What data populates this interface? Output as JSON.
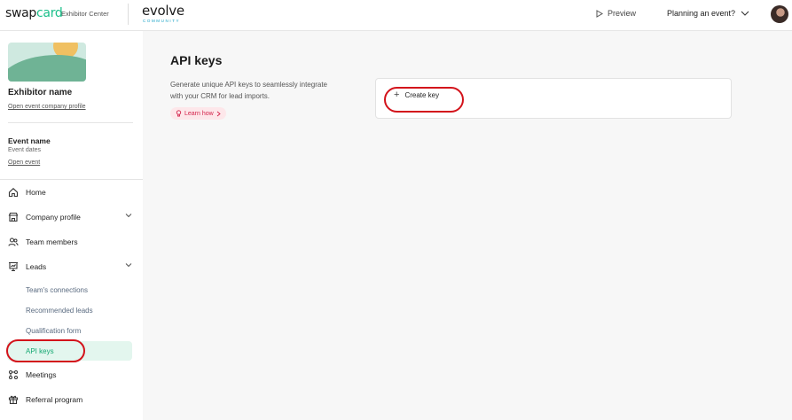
{
  "header": {
    "brand_prefix": "swap",
    "brand_accent": "card",
    "brand_sub": "Exhibitor Center",
    "event_logo": "evolve",
    "event_logo_sub": "COMMUNITY",
    "preview_label": "Preview",
    "planning_label": "Planning an event?"
  },
  "sidebar": {
    "exhibitor_name": "Exhibitor name",
    "company_profile_link": "Open event company profile",
    "event_name": "Event name",
    "event_dates": "Event dates",
    "open_event_link": "Open event",
    "nav": {
      "home": "Home",
      "company_profile": "Company profile",
      "team_members": "Team members",
      "leads": "Leads",
      "teams_connections": "Team's connections",
      "recommended_leads": "Recommended leads",
      "qualification_form": "Qualification form",
      "api_keys": "API keys",
      "meetings": "Meetings",
      "referral_program": "Referral program"
    }
  },
  "main": {
    "title": "API keys",
    "description": "Generate unique API keys to seamlessly integrate with your CRM for lead imports.",
    "learn_how": "Learn how",
    "create_key": "Create key"
  },
  "colors": {
    "accent_green": "#15a872",
    "highlight_red": "#d3131b",
    "learn_pink": "#d3224a"
  }
}
